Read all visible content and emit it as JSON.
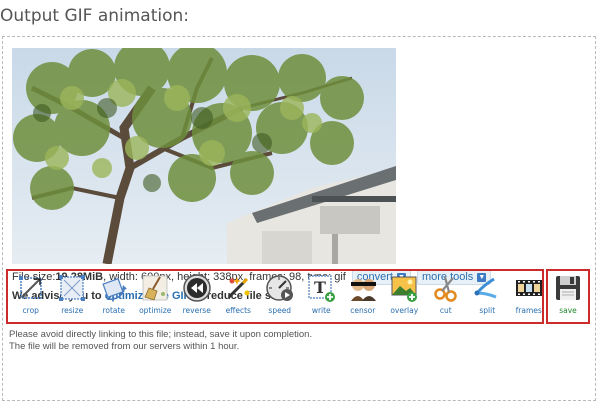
{
  "page": {
    "title": "Output GIF animation:"
  },
  "file_info": {
    "size_prefix": "File size: ",
    "size_value": "19.28MiB",
    "details": ", width: 600px, height: 338px, frames: 98, type: gif",
    "convert_label": "convert",
    "more_tools_label": "more tools"
  },
  "advice": {
    "prefix": "We advise you to ",
    "link": "optimize the GIF",
    "suffix": " to reduce file size!"
  },
  "tools": [
    {
      "label": "crop",
      "icon": "crop-icon"
    },
    {
      "label": "resize",
      "icon": "resize-icon"
    },
    {
      "label": "rotate",
      "icon": "rotate-icon"
    },
    {
      "label": "optimize",
      "icon": "optimize-broom-icon"
    },
    {
      "label": "reverse",
      "icon": "reverse-icon"
    },
    {
      "label": "effects",
      "icon": "effects-wand-icon"
    },
    {
      "label": "speed",
      "icon": "speed-icon"
    },
    {
      "label": "write",
      "icon": "write-text-icon"
    },
    {
      "label": "censor",
      "icon": "censor-icon"
    },
    {
      "label": "overlay",
      "icon": "overlay-image-icon"
    },
    {
      "label": "cut",
      "icon": "scissors-icon"
    },
    {
      "label": "split",
      "icon": "split-icon"
    },
    {
      "label": "frames",
      "icon": "film-frames-icon"
    }
  ],
  "save": {
    "label": "save",
    "icon": "floppy-disk-icon"
  },
  "notice": {
    "line1": "Please avoid directly linking to this file; instead, save it upon completion.",
    "line2": "The file will be removed from our servers within 1 hour."
  },
  "colors": {
    "link": "#2a6fb0",
    "highlight_border": "#cc2b2b",
    "save_label": "#1e8a2c"
  }
}
